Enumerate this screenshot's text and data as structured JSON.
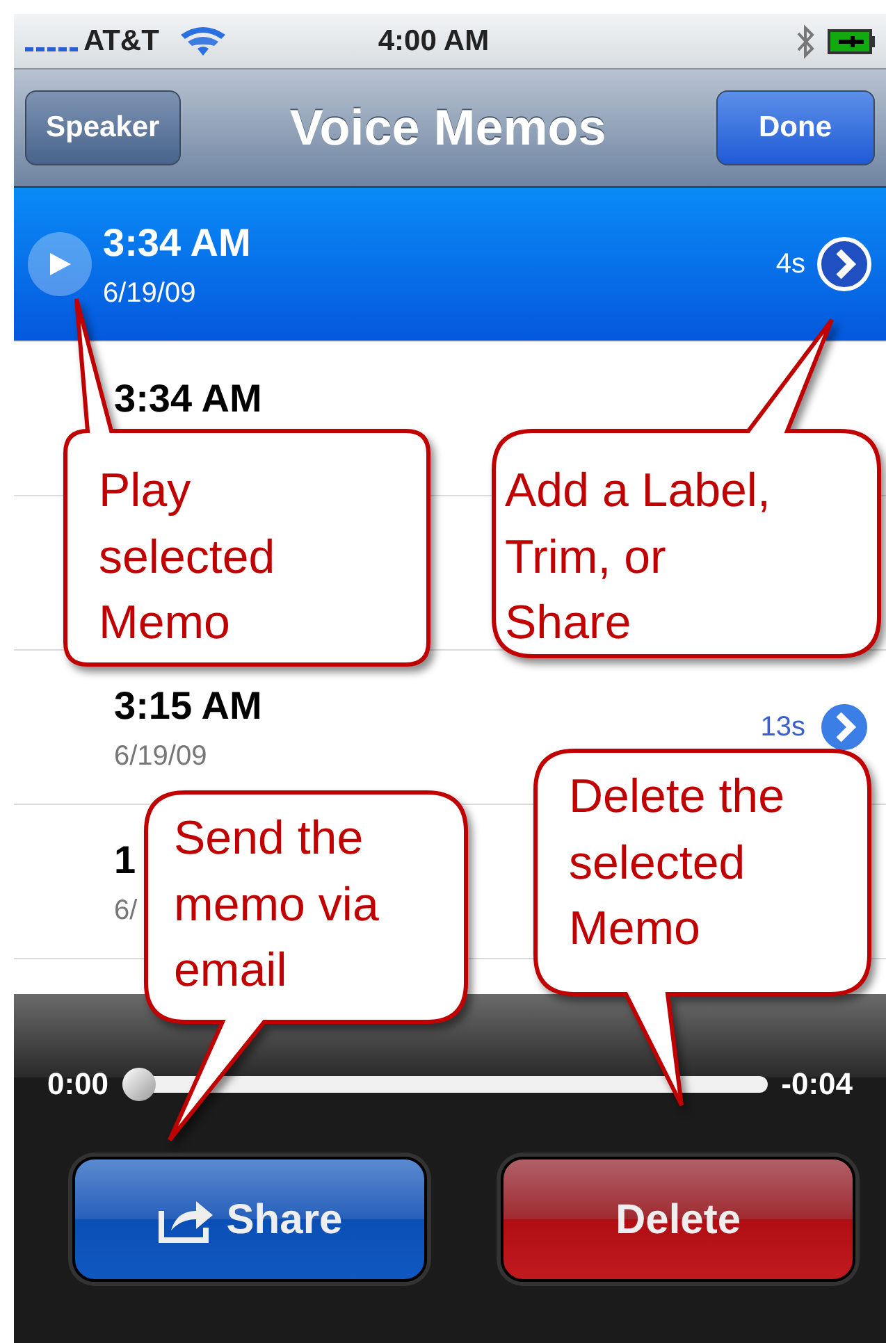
{
  "status_bar": {
    "carrier": "AT&T",
    "time": "4:00 AM"
  },
  "nav_bar": {
    "left_button": "Speaker",
    "title": "Voice Memos",
    "right_button": "Done"
  },
  "memos": [
    {
      "time": "3:34 AM",
      "date": "6/19/09",
      "duration": "4s",
      "selected": true
    },
    {
      "time": "3:34 AM",
      "selected": false
    },
    {
      "selected": false
    },
    {
      "time": "3:15 AM",
      "date": "6/19/09",
      "duration": "13s",
      "selected": false
    },
    {
      "time": "1",
      "date": "6/",
      "selected": false
    }
  ],
  "player": {
    "elapsed": "0:00",
    "remaining": "-0:04",
    "level": 0,
    "share_button": "Share",
    "delete_button": "Delete"
  },
  "callouts": [
    {
      "text": "Play selected Memo"
    },
    {
      "text": "Add a Label, Trim, or Share"
    },
    {
      "text": "Delete the selected Memo"
    },
    {
      "text": "Send the memo via email"
    }
  ]
}
